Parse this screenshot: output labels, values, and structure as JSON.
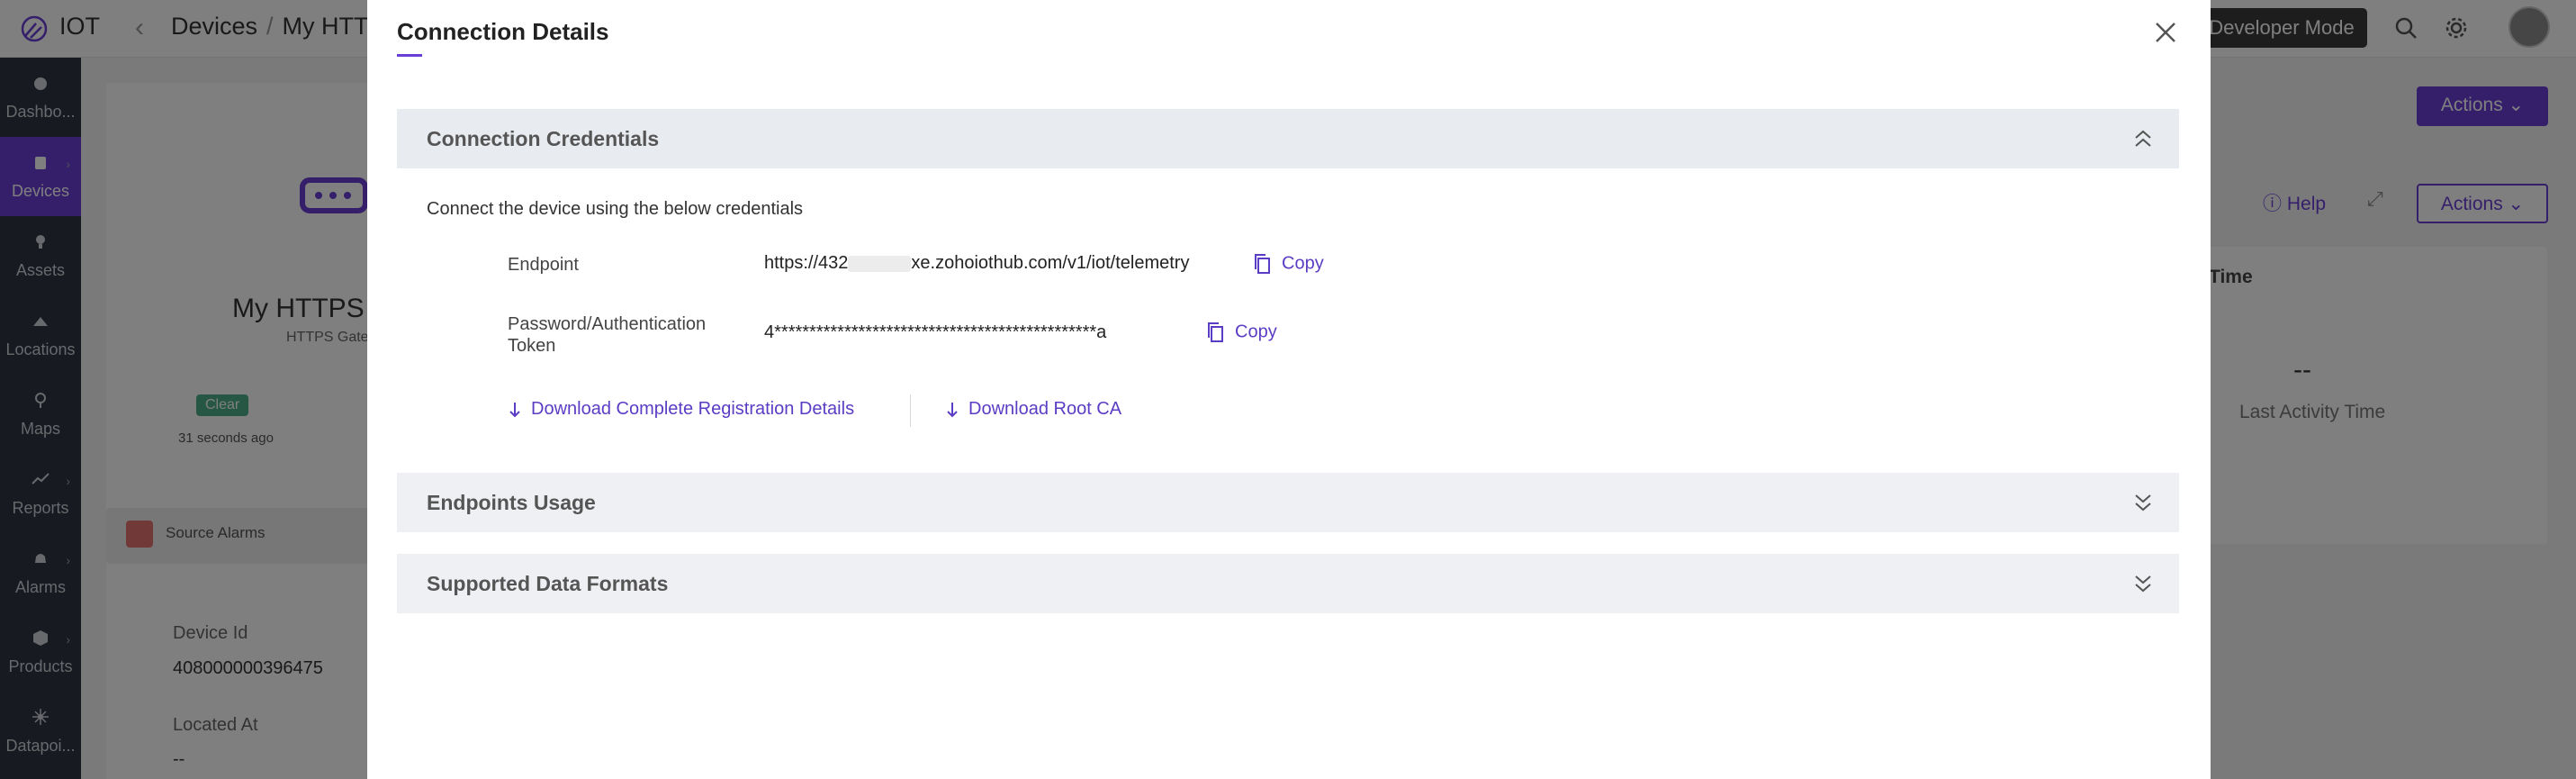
{
  "app": {
    "name": "IOT"
  },
  "breadcrumb": {
    "parent": "Devices",
    "separator": "/",
    "current": "My HTTPS"
  },
  "header": {
    "developer_mode_label": "Developer Mode",
    "icons": [
      "search-icon",
      "gear-icon",
      "avatar"
    ]
  },
  "sidebar": {
    "items": [
      {
        "label": "Dashbo...",
        "icon": "dashboard-icon",
        "active": false
      },
      {
        "label": "Devices",
        "icon": "devices-icon",
        "active": true
      },
      {
        "label": "Assets",
        "icon": "assets-icon",
        "active": false
      },
      {
        "label": "Locations",
        "icon": "locations-icon",
        "active": false
      },
      {
        "label": "Maps",
        "icon": "maps-icon",
        "active": false
      },
      {
        "label": "Reports",
        "icon": "reports-icon",
        "active": false
      },
      {
        "label": "Alarms",
        "icon": "alarms-icon",
        "active": false
      },
      {
        "label": "Products",
        "icon": "products-icon",
        "active": false
      },
      {
        "label": "Datapoi...",
        "icon": "datapoints-icon",
        "active": false
      }
    ]
  },
  "background": {
    "device_name": "My HTTPS",
    "device_type": "HTTPS Gate",
    "status_badge": "Clear",
    "status_time": "31 seconds ago",
    "source_alarms_label": "Source Alarms",
    "device_id_label": "Device Id",
    "device_id_value": "408000000396475",
    "located_at_label": "Located At",
    "located_at_value": "--",
    "actions_label": "Actions",
    "help_label": "Help",
    "time_header": "Time",
    "last_activity_value": "--",
    "last_activity_label": "Last Activity Time"
  },
  "modal": {
    "title": "Connection Details",
    "sections": {
      "credentials": {
        "title": "Connection Credentials",
        "expanded": true
      },
      "usage": {
        "title": "Endpoints Usage",
        "expanded": false
      },
      "formats": {
        "title": "Supported Data Formats",
        "expanded": false
      }
    },
    "intro": "Connect the device using the below credentials",
    "endpoint_label": "Endpoint",
    "endpoint_value_prefix": "https://432",
    "endpoint_value_suffix": "xe.zohoiothub.com/v1/iot/telemetry",
    "token_label_line1": "Password/Authentication",
    "token_label_line2": "Token",
    "token_value": "4**********************************************a",
    "copy_label": "Copy",
    "download_registration_label": "Download Complete Registration Details",
    "download_root_ca_label": "Download Root CA"
  },
  "colors": {
    "accent": "#6a3fd6",
    "link": "#5b3cc4",
    "sidebar": "#2f3440"
  }
}
